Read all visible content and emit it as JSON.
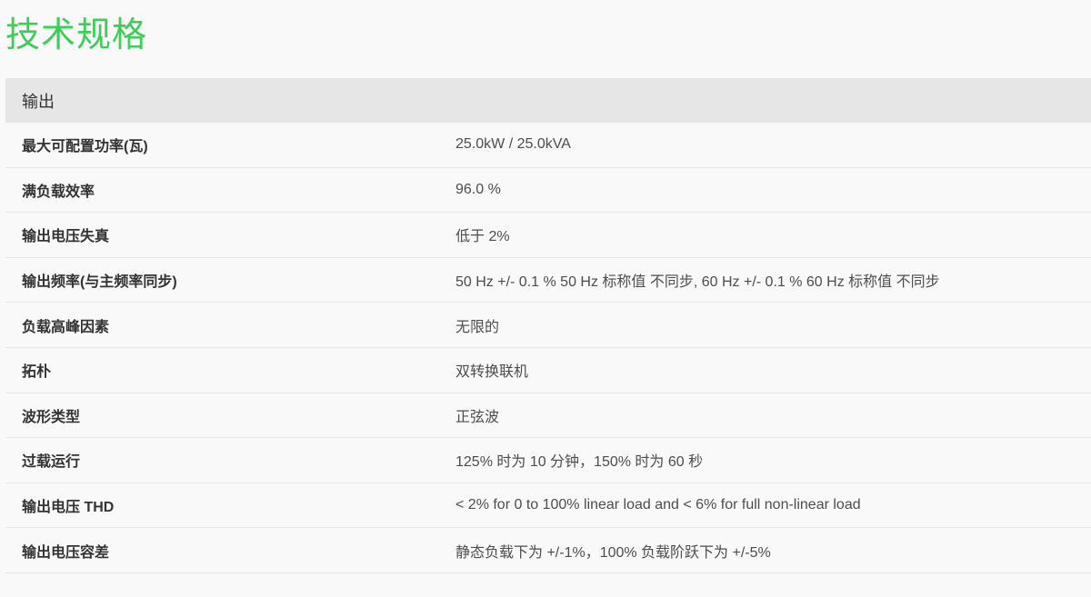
{
  "title": "技术规格",
  "section": {
    "header": "输出",
    "rows": [
      {
        "label": "最大可配置功率(瓦)",
        "value": "25.0kW / 25.0kVA"
      },
      {
        "label": "满负载效率",
        "value": "96.0 %"
      },
      {
        "label": "输出电压失真",
        "value": "低于 2%"
      },
      {
        "label": "输出频率(与主频率同步)",
        "value": "50 Hz +/- 0.1 % 50 Hz 标称值 不同步, 60 Hz +/- 0.1 % 60 Hz 标称值 不同步"
      },
      {
        "label": "负载高峰因素",
        "value": "无限的"
      },
      {
        "label": "拓朴",
        "value": "双转换联机"
      },
      {
        "label": "波形类型",
        "value": "正弦波"
      },
      {
        "label": "过载运行",
        "value": "125% 时为 10 分钟，150% 时为 60 秒"
      },
      {
        "label": "输出电压 THD",
        "value": "< 2% for 0 to 100% linear load and < 6% for full non-linear load"
      },
      {
        "label": "输出电压容差",
        "value": "静态负载下为 +/-1%，100% 负载阶跃下为 +/-5%"
      }
    ]
  },
  "colors": {
    "title": "#3dcd58",
    "header_bg": "#e6e6e6",
    "page_bg": "#f9f9f9"
  }
}
